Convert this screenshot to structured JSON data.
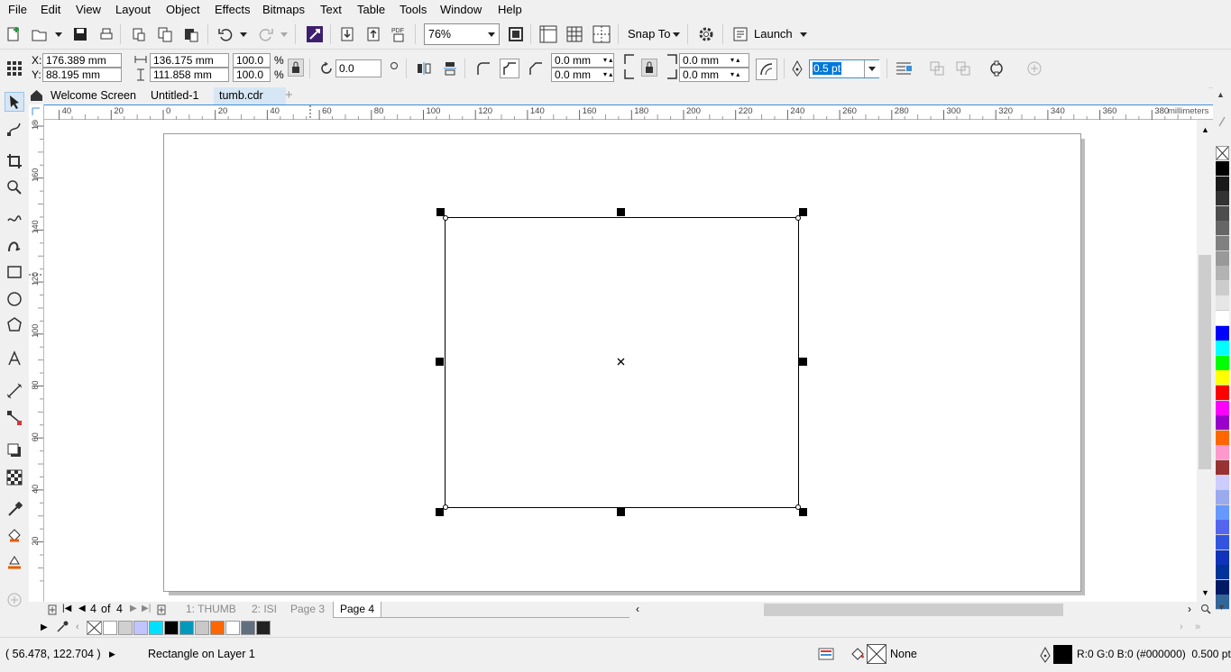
{
  "menu": [
    "File",
    "Edit",
    "View",
    "Layout",
    "Object",
    "Effects",
    "Bitmaps",
    "Text",
    "Table",
    "Tools",
    "Window",
    "Help"
  ],
  "toolbar": {
    "zoom": "76%",
    "snap_to": "Snap To",
    "launch": "Launch",
    "pdf_label": "PDF"
  },
  "props": {
    "x": "176.389 mm",
    "y": "88.195 mm",
    "width": "136.175 mm",
    "height": "111.858 mm",
    "scale_x": "100.0",
    "scale_y": "100.0",
    "percent": "%",
    "x_label": "X:",
    "y_label": "Y:",
    "rotation": "0.0",
    "corner_1": "0.0 mm",
    "corner_2": "0.0 mm",
    "corner_3": "0.0 mm",
    "corner_4": "0.0 mm",
    "outline": "0.5 pt"
  },
  "tabs": [
    "Welcome Screen",
    "Untitled-1",
    "tumb.cdr"
  ],
  "ruler": {
    "h_labels": [
      "40",
      "20",
      "0",
      "20",
      "40",
      "60",
      "80",
      "100",
      "120",
      "140",
      "160",
      "180",
      "200",
      "220",
      "240",
      "260",
      "280",
      "300",
      "320",
      "340",
      "360",
      "380"
    ],
    "units": "millimeters",
    "v_labels": [
      "180",
      "160",
      "140",
      "120",
      "100",
      "80",
      "60",
      "40",
      "20"
    ]
  },
  "pagenav": {
    "current": "4",
    "of": "of",
    "total": "4",
    "pages": [
      "1: THUMB",
      "2: ISI",
      "Page 3",
      "Page 4"
    ]
  },
  "colors": {
    "palette": [
      "#000000",
      "#1a1a1a",
      "#333333",
      "#4d4d4d",
      "#666666",
      "#808080",
      "#999999",
      "#b3b3b3",
      "#cccccc",
      "#e6e6e6",
      "#ffffff",
      "#0000ff",
      "#00ffff",
      "#00ff00",
      "#ffff00",
      "#ff0000",
      "#ff00ff",
      "#9900cc",
      "#ff6600",
      "#ff99cc",
      "#993333",
      "#ccccff",
      "#99aaee",
      "#6699ff",
      "#5566ee",
      "#3355dd",
      "#1133bb",
      "#003399",
      "#001a66",
      "#336699"
    ],
    "docpal": [
      "#ffffff",
      "#d0d0d0",
      "#c0c4ff",
      "#00e0ff",
      "#000000",
      "#0099bb",
      "#c8c8c8",
      "#ff6600",
      "#ffffff",
      "#607080",
      "#222222"
    ]
  },
  "status": {
    "coords": "( 56.478, 122.704 )",
    "object": "Rectangle on Layer 1",
    "fill": "None",
    "outline_info": "R:0 G:0 B:0 (#000000)  0.500 pt"
  }
}
